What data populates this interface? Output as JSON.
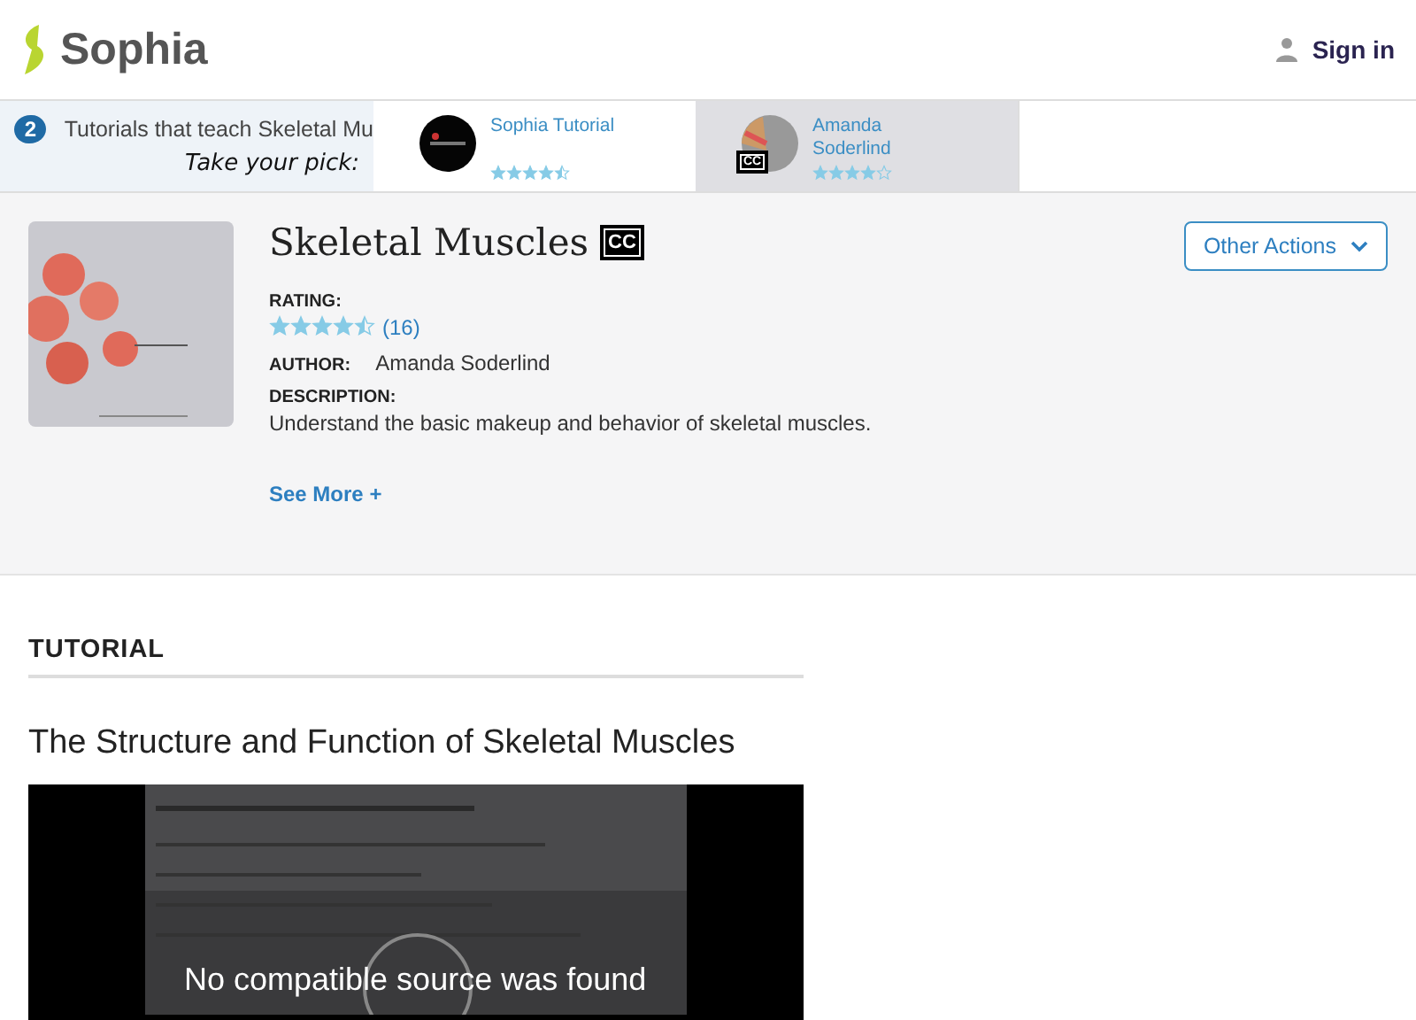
{
  "header": {
    "logo": "Sophia",
    "sign_in": "Sign in"
  },
  "picker": {
    "count": "2",
    "text": "Tutorials that teach Skeletal Mu",
    "handwritten": "Take your pick:",
    "options": [
      {
        "name": "Sophia Tutorial",
        "stars": 4.5,
        "selected": false
      },
      {
        "name": "Amanda Soderlind",
        "stars": 4,
        "cc_badge": "CC",
        "selected": true
      }
    ]
  },
  "summary": {
    "title": "Skeletal Muscles",
    "cc": "CC",
    "rating_label": "RATING:",
    "stars": 4.5,
    "rating_count": "(16)",
    "author_label": "AUTHOR:",
    "author": "Amanda Soderlind",
    "description_label": "DESCRIPTION:",
    "description": "Understand the basic makeup and behavior of skeletal muscles.",
    "see_more": "See More +",
    "other_actions": "Other Actions"
  },
  "tutorial": {
    "heading": "TUTORIAL",
    "title": "The Structure and Function of Skeletal Muscles",
    "video": {
      "kind": "picture",
      "message": "No compatible source was found"
    }
  }
}
